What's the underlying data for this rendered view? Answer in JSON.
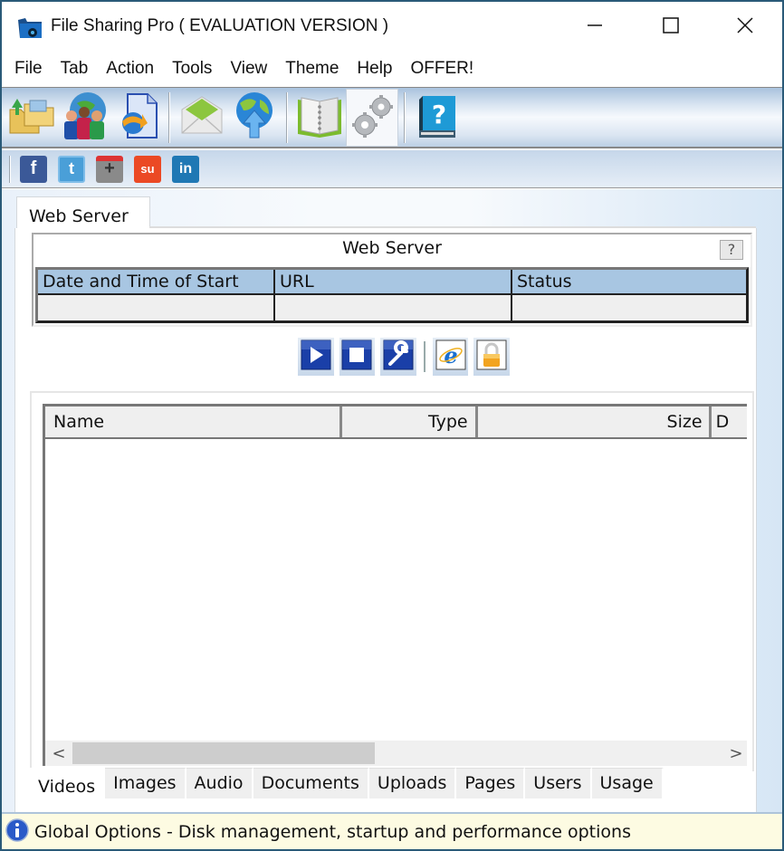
{
  "window": {
    "title": "File Sharing Pro ( EVALUATION VERSION )",
    "app_icon": "file-sharing-pro-icon",
    "controls": [
      "minimize-icon",
      "maximize-icon",
      "close-icon"
    ]
  },
  "menu": {
    "items": [
      "File",
      "Tab",
      "Action",
      "Tools",
      "View",
      "Theme",
      "Help",
      "OFFER!"
    ]
  },
  "toolbar": {
    "buttons": [
      {
        "icon": "open-folders-icon",
        "active": false
      },
      {
        "icon": "users-globe-icon",
        "active": false
      },
      {
        "icon": "share-document-icon",
        "active": false
      },
      {
        "separator": true
      },
      {
        "icon": "email-envelope-icon",
        "active": false
      },
      {
        "icon": "globe-upload-icon",
        "active": false
      },
      {
        "separator": true
      },
      {
        "icon": "address-book-icon",
        "active": false
      },
      {
        "icon": "gears-options-icon",
        "active": true
      },
      {
        "separator": true
      },
      {
        "icon": "help-book-icon",
        "active": false
      }
    ]
  },
  "social": {
    "buttons": [
      {
        "icon": "facebook-icon",
        "glyph": "f",
        "color": "#3b5998"
      },
      {
        "icon": "twitter-icon",
        "glyph": "t",
        "color": "#4a9fd8"
      },
      {
        "icon": "google-plus-icon",
        "glyph": "+",
        "color": "#8a8a8a"
      },
      {
        "icon": "stumbleupon-icon",
        "glyph": "su",
        "color": "#eb4924"
      },
      {
        "icon": "linkedin-icon",
        "glyph": "in",
        "color": "#1f78b4"
      }
    ]
  },
  "main": {
    "tab_label": "Web Server",
    "web_server": {
      "title": "Web Server",
      "help_label": "?",
      "columns": [
        "Date and Time of Start",
        "URL",
        "Status"
      ],
      "rows": [
        [
          "",
          "",
          ""
        ]
      ]
    },
    "controls": [
      "play-icon",
      "stop-icon",
      "settings-wrench-icon",
      "internet-explorer-icon",
      "lock-icon"
    ],
    "files": {
      "columns": [
        "Name",
        "Type",
        "Size",
        "D"
      ],
      "rows": []
    },
    "scroll": {
      "left": "<",
      "right": ">"
    },
    "bottom_tabs": [
      "Videos",
      "Images",
      "Audio",
      "Documents",
      "Uploads",
      "Pages",
      "Users",
      "Usage"
    ],
    "active_bottom_tab": "Videos"
  },
  "status": {
    "icon": "info-icon",
    "text": "Global Options - Disk management, startup and performance options"
  }
}
